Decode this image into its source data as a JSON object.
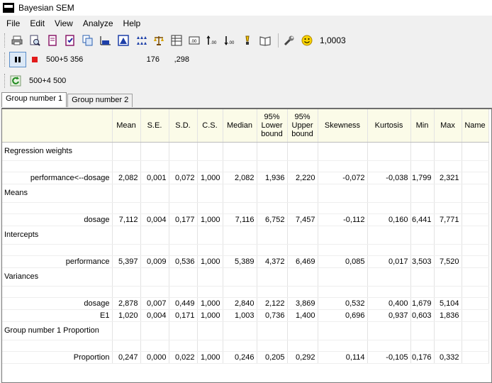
{
  "window": {
    "title": "Bayesian SEM"
  },
  "menu": [
    "File",
    "Edit",
    "View",
    "Analyze",
    "Help"
  ],
  "toolbar": {
    "convergence_value": "1,0003"
  },
  "run": {
    "samples": "500+5 356",
    "value_a": "176",
    "value_b": ",298"
  },
  "burnin": {
    "label": "500+4 500"
  },
  "tabs": [
    "Group number 1",
    "Group number 2"
  ],
  "table": {
    "headers": [
      "Mean",
      "S.E.",
      "S.D.",
      "C.S.",
      "Median",
      "95%\nLower\nbound",
      "95%\nUpper\nbound",
      "Skewness",
      "Kurtosis",
      "Min",
      "Max",
      "Name"
    ],
    "sections": [
      {
        "title": "Regression weights",
        "rows": [
          {
            "label": "performance<--dosage",
            "values": [
              "2,082",
              "0,001",
              "0,072",
              "1,000",
              "2,082",
              "1,936",
              "2,220",
              "-0,072",
              "-0,038",
              "1,799",
              "2,321",
              ""
            ]
          }
        ]
      },
      {
        "title": "Means",
        "rows": [
          {
            "label": "dosage",
            "values": [
              "7,112",
              "0,004",
              "0,177",
              "1,000",
              "7,116",
              "6,752",
              "7,457",
              "-0,112",
              "0,160",
              "6,441",
              "7,771",
              ""
            ]
          }
        ]
      },
      {
        "title": "Intercepts",
        "rows": [
          {
            "label": "performance",
            "values": [
              "5,397",
              "0,009",
              "0,536",
              "1,000",
              "5,389",
              "4,372",
              "6,469",
              "0,085",
              "0,017",
              "3,503",
              "7,520",
              ""
            ]
          }
        ]
      },
      {
        "title": "Variances",
        "rows": [
          {
            "label": "dosage",
            "values": [
              "2,878",
              "0,007",
              "0,449",
              "1,000",
              "2,840",
              "2,122",
              "3,869",
              "0,532",
              "0,400",
              "1,679",
              "5,104",
              ""
            ]
          },
          {
            "label": "E1",
            "values": [
              "1,020",
              "0,004",
              "0,171",
              "1,000",
              "1,003",
              "0,736",
              "1,400",
              "0,696",
              "0,937",
              "0,603",
              "1,836",
              ""
            ]
          }
        ]
      },
      {
        "title": "Group number 1 Proportion",
        "rows": [
          {
            "label": "Proportion",
            "values": [
              "0,247",
              "0,000",
              "0,022",
              "1,000",
              "0,246",
              "0,205",
              "0,292",
              "0,114",
              "-0,105",
              "0,176",
              "0,332",
              ""
            ]
          }
        ]
      }
    ]
  }
}
